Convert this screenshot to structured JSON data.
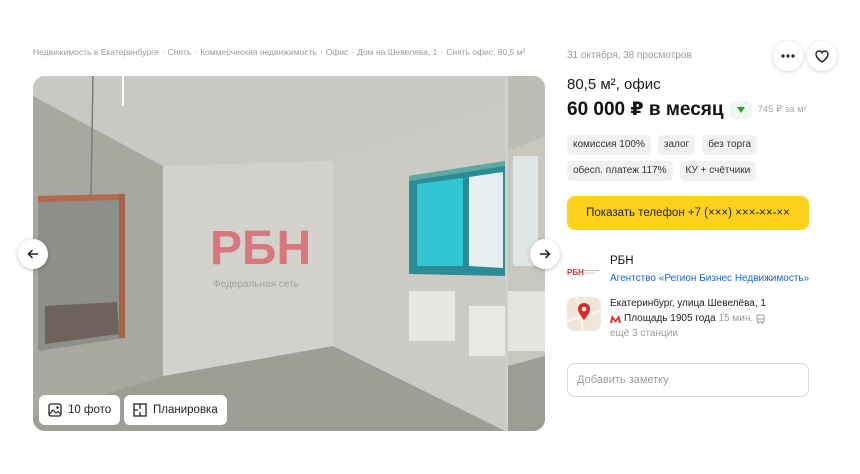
{
  "breadcrumbs": [
    "Недвижимость в Екатеринбурге",
    "Снять",
    "Коммерческая недвижимость",
    "Офис",
    "Дом на Шевелева, 1",
    "Снять офис, 80,5 м²"
  ],
  "breadcrumb_separator": "·",
  "gallery": {
    "watermark_text": "Федеральная сеть",
    "photos_button": "10 фото",
    "plan_button": "Планировка"
  },
  "listing": {
    "meta": "31 октября, 38 просмотров",
    "title": "80,5 м², офис",
    "price": "60 000 ₽ в месяц",
    "price_per_sqm": "745 ₽ за м²",
    "tags": [
      "комиссия 100%",
      "залог",
      "без торга",
      "обесп. платеж 117%",
      "КУ + счётчики"
    ],
    "phone_button": "Показать телефон +7 (×××) ×××-××-××"
  },
  "agent": {
    "logo_text": "РБН",
    "name": "РБН",
    "organization": "Агентство «Регион Бизнес Недвижимость»"
  },
  "location": {
    "address": "Екатеринбург, улица Шевелёва, 1",
    "metro_station": "Площадь 1905 года",
    "metro_time": "15 мин.",
    "more_stations": "ещё 3 станции"
  },
  "note": {
    "placeholder": "Добавить заметку"
  },
  "colors": {
    "accent_yellow": "#fcd21c",
    "link_blue": "#1766d6",
    "metro_red": "#e0262b",
    "price_down_green": "#21a038"
  },
  "icons": {
    "prev": "arrow-left-icon",
    "next": "arrow-right-icon",
    "more": "more-dots-icon",
    "favorite": "heart-icon",
    "photos": "image-icon",
    "plan": "floorplan-icon",
    "metro": "metro-icon",
    "walk": "bus-icon"
  }
}
